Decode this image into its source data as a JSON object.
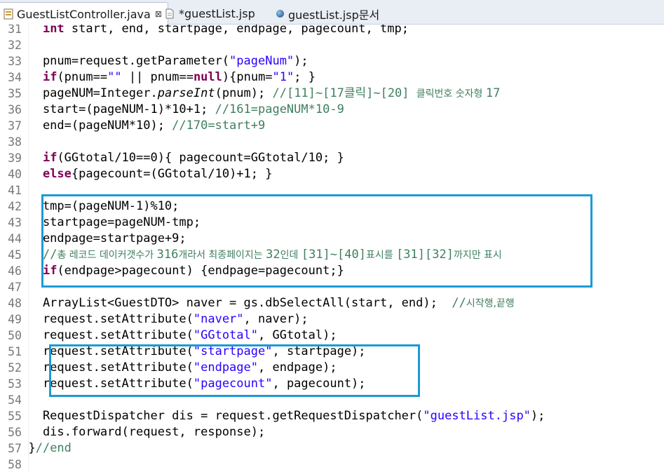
{
  "tabs": [
    {
      "label": "GuestListController.java",
      "close": "⊠",
      "active": true,
      "icon": "java-file-icon"
    },
    {
      "label": "*guestList.jsp",
      "active": false,
      "icon": "jsp-file-icon"
    },
    {
      "label": "guestList.jsp문서",
      "active": false,
      "icon": "globe-icon"
    }
  ],
  "highlight_color": "#1c9ad6",
  "lines": [
    {
      "n": "31",
      "tokens": [
        [
          "",
          "    "
        ],
        [
          "kw",
          "int"
        ],
        [
          "",
          " start, end, startpage, endpage, pagecount, tmp;"
        ]
      ]
    },
    {
      "n": "32",
      "tokens": []
    },
    {
      "n": "33",
      "tokens": [
        [
          "",
          "    pnum=request.getParameter("
        ],
        [
          "str",
          "\"pageNum\""
        ],
        [
          "",
          ");"
        ]
      ]
    },
    {
      "n": "34",
      "tokens": [
        [
          "",
          "    "
        ],
        [
          "kw",
          "if"
        ],
        [
          "",
          "(pnum=="
        ],
        [
          "str",
          "\"\""
        ],
        [
          "",
          " || pnum=="
        ],
        [
          "kw",
          "null"
        ],
        [
          "",
          "){pnum="
        ],
        [
          "str",
          "\"1\""
        ],
        [
          "",
          "; }"
        ]
      ]
    },
    {
      "n": "35",
      "tokens": [
        [
          "",
          "    pageNUM=Integer."
        ],
        [
          "it",
          "parseInt"
        ],
        [
          "",
          "(pnum); "
        ],
        [
          "cm",
          "//[11]~[17클릭]~[20] "
        ],
        [
          "cm kr",
          "클릭번호 숫자형 "
        ],
        [
          "cm",
          "17"
        ]
      ]
    },
    {
      "n": "36",
      "tokens": [
        [
          "",
          "    start=(pageNUM-1)*10+1; "
        ],
        [
          "cm",
          "//161=pageNUM*10-9"
        ]
      ]
    },
    {
      "n": "37",
      "tokens": [
        [
          "",
          "    end=(pageNUM*10); "
        ],
        [
          "cm",
          "//170=start+9"
        ]
      ]
    },
    {
      "n": "38",
      "tokens": []
    },
    {
      "n": "39",
      "tokens": [
        [
          "",
          "    "
        ],
        [
          "kw",
          "if"
        ],
        [
          "",
          "(GGtotal/10==0){ pagecount=GGtotal/10; }"
        ]
      ]
    },
    {
      "n": "40",
      "tokens": [
        [
          "",
          "    "
        ],
        [
          "kw",
          "else"
        ],
        [
          "",
          "{pagecount=(GGtotal/10)+1; }"
        ]
      ]
    },
    {
      "n": "41",
      "tokens": []
    },
    {
      "n": "42",
      "tokens": [
        [
          "",
          "    tmp=(pageNUM-1)%10;"
        ]
      ]
    },
    {
      "n": "43",
      "tokens": [
        [
          "",
          "    startpage=pageNUM-tmp;"
        ]
      ]
    },
    {
      "n": "44",
      "tokens": [
        [
          "",
          "    endpage=startpage+9;"
        ]
      ]
    },
    {
      "n": "45",
      "tokens": [
        [
          "",
          "    "
        ],
        [
          "cm",
          "//"
        ],
        [
          "cm kr",
          "총 레코드 데이커갯수가 "
        ],
        [
          "cm",
          "316"
        ],
        [
          "cm kr",
          "개라서 최종페이지는 "
        ],
        [
          "cm",
          "32"
        ],
        [
          "cm kr",
          "인데 "
        ],
        [
          "cm",
          "[31]~[40]"
        ],
        [
          "cm kr",
          "표시를 "
        ],
        [
          "cm",
          "[31][32]"
        ],
        [
          "cm kr",
          "까지만 표시"
        ]
      ]
    },
    {
      "n": "46",
      "tokens": [
        [
          "",
          "    "
        ],
        [
          "kw",
          "if"
        ],
        [
          "",
          "(endpage>pagecount) {endpage=pagecount;}"
        ]
      ]
    },
    {
      "n": "47",
      "tokens": []
    },
    {
      "n": "48",
      "tokens": [
        [
          "",
          "    ArrayList<GuestDTO> naver = gs.dbSelectAll(start, end);  "
        ],
        [
          "cm",
          "//"
        ],
        [
          "cm kr",
          "시작행,끝행"
        ]
      ]
    },
    {
      "n": "49",
      "tokens": [
        [
          "",
          "    request.setAttribute("
        ],
        [
          "str",
          "\"naver\""
        ],
        [
          "",
          ", naver);"
        ]
      ]
    },
    {
      "n": "50",
      "tokens": [
        [
          "",
          "    request.setAttribute("
        ],
        [
          "str",
          "\"GGtotal\""
        ],
        [
          "",
          ", GGtotal);"
        ]
      ]
    },
    {
      "n": "51",
      "tokens": [
        [
          "",
          "    request.setAttribute("
        ],
        [
          "str",
          "\"startpage\""
        ],
        [
          "",
          ", startpage);"
        ]
      ]
    },
    {
      "n": "52",
      "tokens": [
        [
          "",
          "    request.setAttribute("
        ],
        [
          "str",
          "\"endpage\""
        ],
        [
          "",
          ", endpage);"
        ]
      ]
    },
    {
      "n": "53",
      "tokens": [
        [
          "",
          "    request.setAttribute("
        ],
        [
          "str",
          "\"pagecount\""
        ],
        [
          "",
          ", pagecount);"
        ]
      ]
    },
    {
      "n": "54",
      "tokens": []
    },
    {
      "n": "55",
      "tokens": [
        [
          "",
          "    RequestDispatcher dis = request.getRequestDispatcher("
        ],
        [
          "str",
          "\"guestList.jsp\""
        ],
        [
          "",
          ");"
        ]
      ]
    },
    {
      "n": "56",
      "tokens": [
        [
          "",
          "    dis.forward(request, response);"
        ]
      ]
    },
    {
      "n": "57",
      "tokens": [
        [
          "",
          "  }"
        ],
        [
          "cm",
          "//end"
        ]
      ]
    },
    {
      "n": "58",
      "tokens": []
    }
  ]
}
